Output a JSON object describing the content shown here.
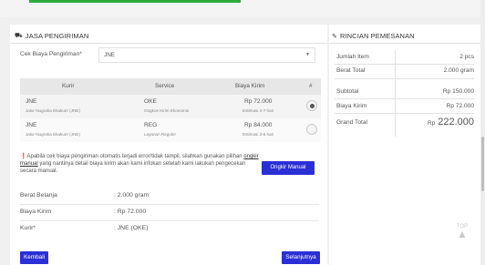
{
  "shipping": {
    "title": "JASA PENGIRIMAN",
    "cost_label": "Cek Biaya Pengiriman*",
    "courier_selected": "JNE",
    "table": {
      "headers": [
        "Kurir",
        "Service",
        "Biaya Kirim",
        "#"
      ],
      "rows": [
        {
          "courier": "JNE",
          "courier_sub": "Jalur Nugraha Ekakurir (JNE)",
          "service": "OKE",
          "service_sub": "Ongkos Kirim Ekonomis",
          "cost": "Rp 72.000",
          "estimate": "Estimasi 4-7 hari",
          "selected": true
        },
        {
          "courier": "JNE",
          "courier_sub": "Jalur Nugraha Ekakurir (JNE)",
          "service": "REG",
          "service_sub": "Layanan Reguler",
          "cost": "Rp 84.000",
          "estimate": "Estimasi 3-6 hari",
          "selected": false
        }
      ]
    },
    "info_icon": "exclamation-circle-icon",
    "info_text_1": "Apabila cek biaya pengiriman otomatis terjadi error/tidak tampil, silahkan gunakan pilihan ",
    "info_link": "ongkir manual",
    "info_text_2": " yang nantinya detail biaya kirim akan kami infokan setelah kami lakukan pengecekan secara manual.",
    "manual_button": "Ongkir Manual",
    "weight_label": "Berat Belanja",
    "weight_value": ": 2.000 gram",
    "shipping_cost_label": "Biaya Kirim",
    "shipping_cost_value": ": Rp 72.000",
    "courier_label": "Kurir*",
    "courier_value": ": JNE (OKE)",
    "back_button": "Kembali",
    "next_button": "Selanjutnya"
  },
  "summary": {
    "title": "RINCIAN PEMESANAN",
    "items_label": "Jumlah Item",
    "items_value": "2 pcs",
    "weight_label": "Berat Total",
    "weight_value": "2.000 gram",
    "subtotal_label": "Subtotal",
    "subtotal_value": "Rp 150.000",
    "shipping_label": "Biaya Kirim",
    "shipping_value": "Rp 72.000",
    "grand_label": "Grand Total",
    "grand_currency": "Rp",
    "grand_value": "222.000"
  },
  "to_top": "TOP",
  "colors": {
    "accent": "#2b2fd6",
    "progress": "#2eaa3a"
  }
}
